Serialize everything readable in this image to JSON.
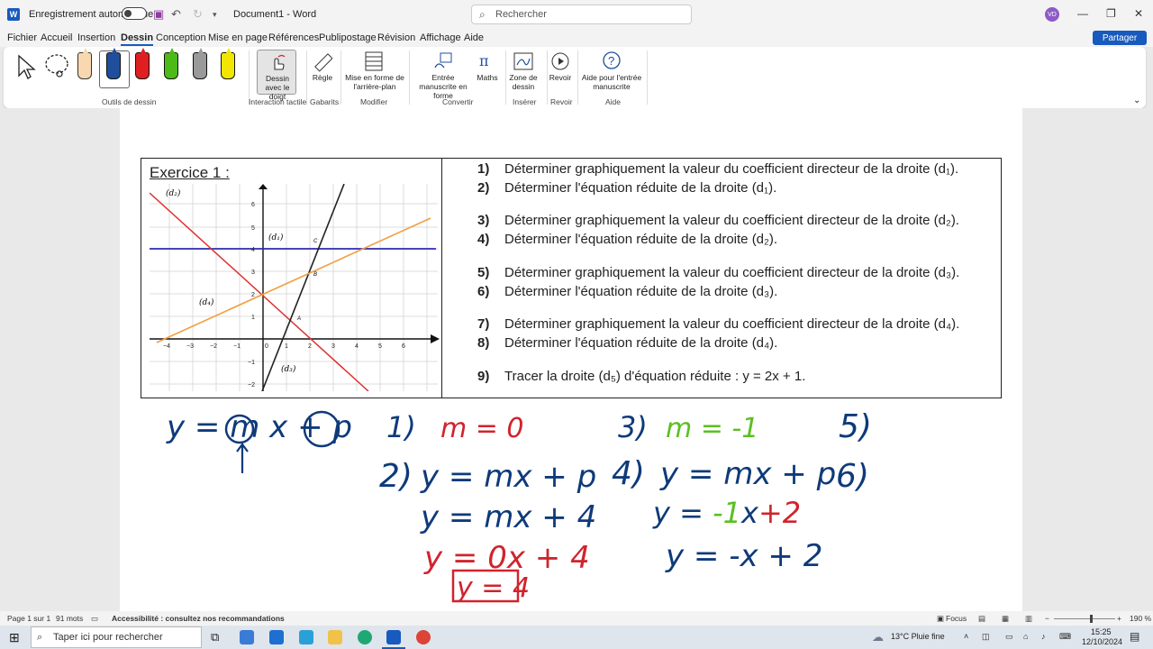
{
  "titlebar": {
    "app_icon": "word-icon",
    "autosave_label": "Enregistrement automatique",
    "doc_title": "Document1  -  Word",
    "search_placeholder": "Rechercher",
    "avatar_initials": "VD"
  },
  "menu": {
    "tabs": [
      "Fichier",
      "Accueil",
      "Insertion",
      "Dessin",
      "Conception",
      "Mise en page",
      "Références",
      "Publipostage",
      "Révision",
      "Affichage",
      "Aide"
    ],
    "active_tab": "Dessin",
    "share_label": "Partager"
  },
  "ribbon": {
    "groups": {
      "outils": "Outils de dessin",
      "interaction": "Interaction tactile",
      "gabarits": "Gabarits",
      "modifier": "Modifier",
      "convertir": "Convertir",
      "inserer": "Insérer",
      "revoir": "Revoir",
      "aide": "Aide"
    },
    "buttons": {
      "dessin_doigt": "Dessin avec le doigt",
      "regle": "Règle",
      "mise_en_forme": "Mise en forme de l'arrière-plan",
      "entree_manuscrite": "Entrée manuscrite en forme",
      "maths": "Maths",
      "zone_dessin": "Zone de dessin",
      "revoir": "Revoir",
      "aide_entree": "Aide pour l'entrée manuscrite"
    },
    "pen_colors": [
      "#222222",
      "#1f4e9c",
      "#e02020",
      "#4cbb17",
      "#7a7a7a",
      "#f2e600"
    ]
  },
  "exercise": {
    "title": "Exercice 1 :",
    "questions": [
      {
        "num": "1)",
        "text": "Déterminer graphiquement la valeur du coefficient directeur de la droite (d₁)."
      },
      {
        "num": "2)",
        "text": "Déterminer l'équation réduite de la droite (d₁)."
      },
      {
        "num": "3)",
        "text": "Déterminer graphiquement la valeur du coefficient directeur de la droite (d₂)."
      },
      {
        "num": "4)",
        "text": "Déterminer l'équation réduite de la droite (d₂)."
      },
      {
        "num": "5)",
        "text": "Déterminer graphiquement la valeur du coefficient directeur de la droite (d₃)."
      },
      {
        "num": "6)",
        "text": "Déterminer l'équation réduite de la droite (d₃)."
      },
      {
        "num": "7)",
        "text": "Déterminer graphiquement la valeur du coefficient directeur de la droite (d₄)."
      },
      {
        "num": "8)",
        "text": "Déterminer l'équation réduite de la droite (d₄)."
      },
      {
        "num": "9)",
        "text": "Tracer la droite (d₅) d'équation réduite : y = 2x + 1."
      }
    ],
    "graph": {
      "labels": {
        "d1": "(d₁)",
        "d2": "(d₂)",
        "d3": "(d₃)",
        "d4": "(d₄)",
        "A": "A",
        "B": "B",
        "C": "C"
      },
      "x_ticks": [
        "−4",
        "−3",
        "−2",
        "−1",
        "0",
        "1",
        "2",
        "3",
        "4",
        "5",
        "6"
      ],
      "y_ticks": [
        "6",
        "5",
        "4",
        "3",
        "2",
        "1",
        "−1",
        "−2"
      ]
    }
  },
  "handwriting": {
    "formula": "y = m x + p",
    "a1": "1)",
    "a1_val": "m = 0",
    "a2": "2)",
    "a2_l1": "y = mx + p",
    "a2_l2": "y = mx + 4",
    "a2_l3": "y = 0x + 4",
    "a2_l4": "y = 4",
    "a3": "3)",
    "a3_val": "m = -1",
    "a4": "4)",
    "a4_l1": "y = mx + p",
    "a4_l2a": "y = ",
    "a4_l2b": "-1",
    "a4_l2c": "x",
    "a4_l2d": "+2",
    "a4_l3": "y = -x + 2",
    "a5": "5)",
    "a6": "6)",
    "colors": {
      "blue": "#0e3a7a",
      "red": "#d0242d",
      "green": "#5bbf22"
    }
  },
  "status": {
    "page": "Page 1 sur 1",
    "words": "91 mots",
    "accessibility": "Accessibilité : consultez nos recommandations",
    "focus": "Focus",
    "zoom": "190 %"
  },
  "taskbar": {
    "search_placeholder": "Taper ici pour rechercher",
    "weather": "13°C  Pluie fine",
    "time": "15:25",
    "date": "12/10/2024"
  }
}
